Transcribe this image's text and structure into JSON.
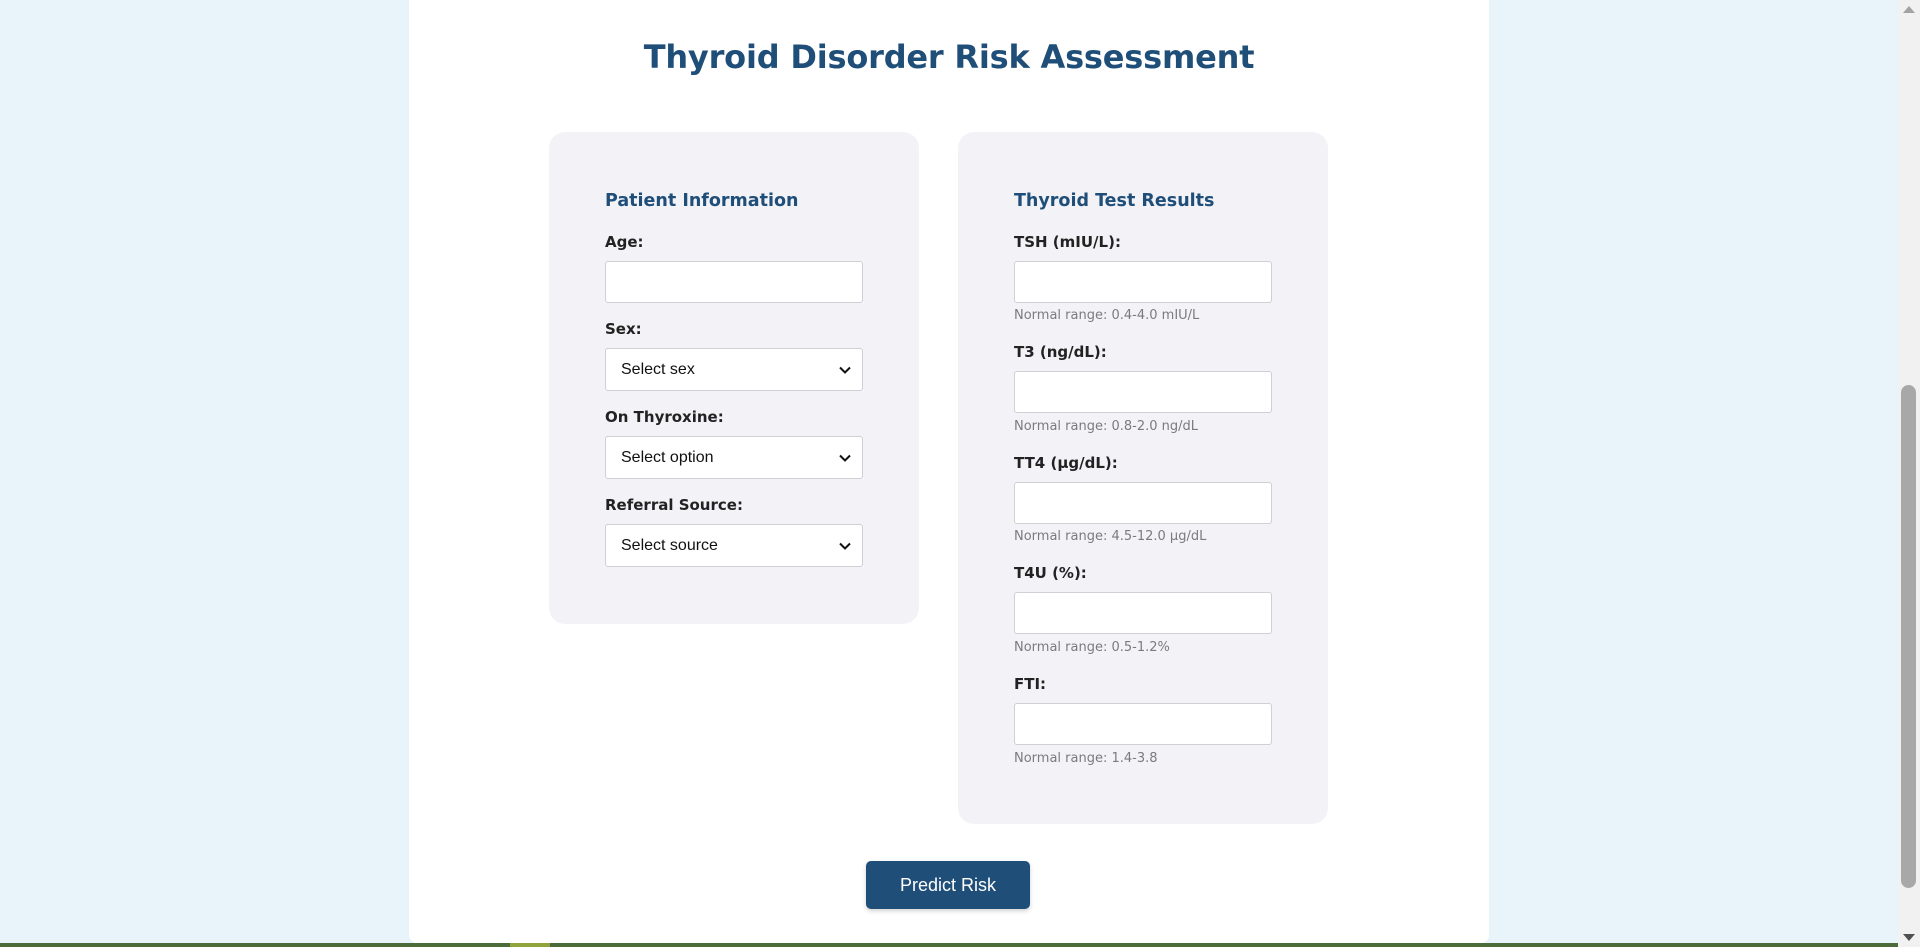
{
  "page": {
    "title": "Thyroid Disorder Risk Assessment"
  },
  "patient_info": {
    "section_title": "Patient Information",
    "age": {
      "label": "Age:",
      "value": ""
    },
    "sex": {
      "label": "Sex:",
      "selected": "Select sex"
    },
    "on_thyroxine": {
      "label": "On Thyroxine:",
      "selected": "Select option"
    },
    "referral_source": {
      "label": "Referral Source:",
      "selected": "Select source"
    }
  },
  "test_results": {
    "section_title": "Thyroid Test Results",
    "tsh": {
      "label": "TSH (mIU/L):",
      "value": "",
      "hint": "Normal range: 0.4-4.0 mIU/L"
    },
    "t3": {
      "label": "T3 (ng/dL):",
      "value": "",
      "hint": "Normal range: 0.8-2.0 ng/dL"
    },
    "tt4": {
      "label": "TT4 (µg/dL):",
      "value": "",
      "hint": "Normal range: 4.5-12.0 µg/dL"
    },
    "t4u": {
      "label": "T4U (%):",
      "value": "",
      "hint": "Normal range: 0.5-1.2%"
    },
    "fti": {
      "label": "FTI:",
      "value": "",
      "hint": "Normal range: 1.4-3.8"
    }
  },
  "actions": {
    "predict_label": "Predict Risk"
  },
  "colors": {
    "accent": "#1f4e79",
    "background": "#e8f4f9",
    "card": "#f3f3f7"
  }
}
